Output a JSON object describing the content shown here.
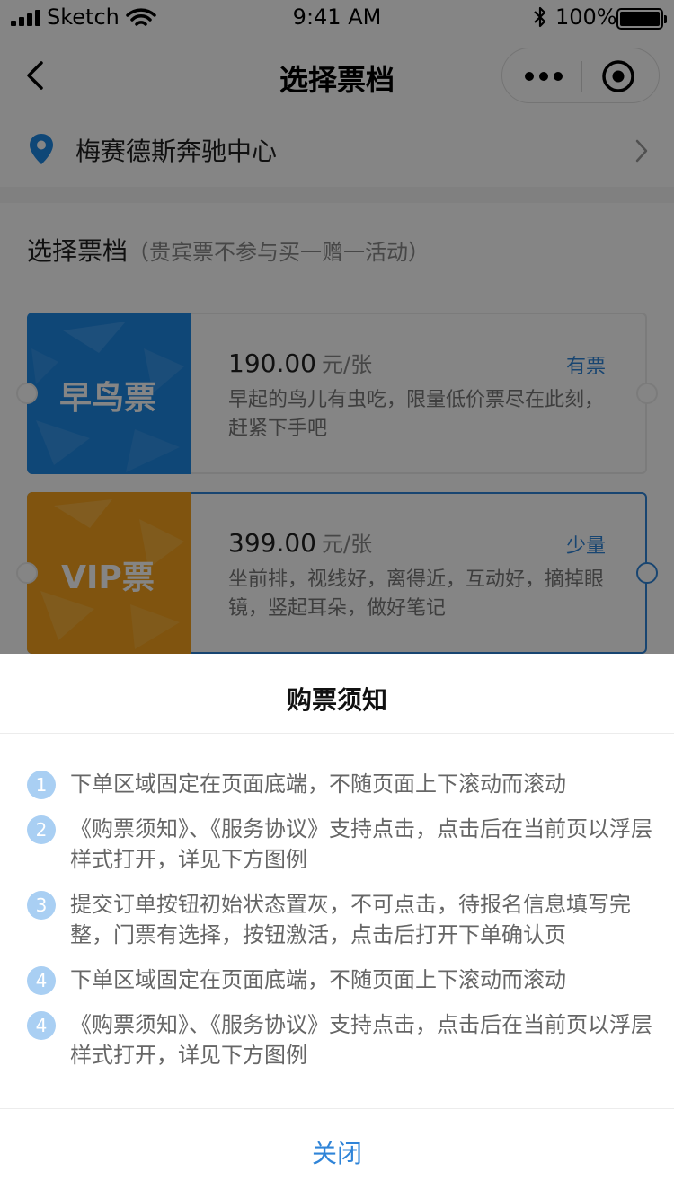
{
  "status_bar": {
    "carrier": "Sketch",
    "time": "9:41 AM",
    "battery": "100%"
  },
  "nav": {
    "title": "选择票档",
    "icons": [
      "back-chevron-icon",
      "more-dots-icon",
      "close-target-icon"
    ]
  },
  "venue": {
    "name": "梅赛德斯奔驰中心"
  },
  "tickets_section": {
    "title": "选择票档",
    "subtitle": "（贵宾票不参与买一赠一活动）",
    "tickets": [
      {
        "name": "早鸟票",
        "price": "190.00",
        "unit": "元/张",
        "stock": "有票",
        "desc": "早起的鸟儿有虫吃，限量低价票尽在此刻，赶紧下手吧",
        "color": "#1e88e5"
      },
      {
        "name": "VIP票",
        "price": "399.00",
        "unit": "元/张",
        "stock": "少量",
        "desc": "坐前排，视线好，离得近，互动好，摘掉眼镜，竖起耳朵，做好笔记",
        "color": "#f5a21d"
      }
    ]
  },
  "sheet": {
    "title": "购票须知",
    "notes": [
      {
        "num": "1",
        "text": "下单区域固定在页面底端，不随页面上下滚动而滚动"
      },
      {
        "num": "2",
        "text": "《购票须知》、《服务协议》支持点击，点击后在当前页以浮层样式打开，详见下方图例"
      },
      {
        "num": "3",
        "text": "提交订单按钮初始状态置灰，不可点击，待报名信息填写完整，门票有选择，按钮激活，点击后打开下单确认页"
      },
      {
        "num": "4",
        "text": "下单区域固定在页面底端，不随页面上下滚动而滚动"
      },
      {
        "num": "4",
        "text": "《购票须知》、《服务协议》支持点击，点击后在当前页以浮层样式打开，详见下方图例"
      }
    ],
    "close_label": "关闭"
  },
  "colors": {
    "accent": "#2f84d8",
    "badge": "#a9cff3",
    "overlay": "rgba(0,0,0,0.48)"
  }
}
